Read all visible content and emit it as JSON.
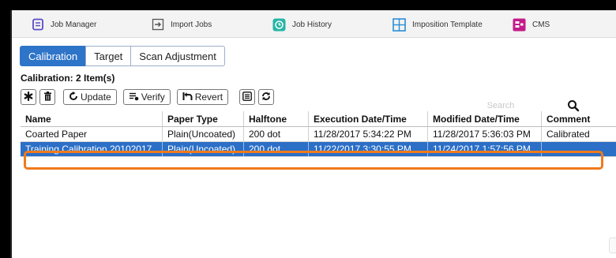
{
  "toolbar": {
    "items": [
      {
        "label": "Job Manager",
        "icon": "job-manager-icon",
        "color": "#5b4cc4"
      },
      {
        "label": "Import Jobs",
        "icon": "import-icon",
        "color": "#555555"
      },
      {
        "label": "Job History",
        "icon": "history-icon",
        "color": "#27b5a6"
      },
      {
        "label": "Imposition Template",
        "icon": "grid-icon",
        "color": "#2a8ed4"
      },
      {
        "label": "CMS",
        "icon": "cms-icon",
        "color": "#c21c8a"
      }
    ]
  },
  "tabs": [
    {
      "label": "Calibration",
      "active": true
    },
    {
      "label": "Target",
      "active": false
    },
    {
      "label": "Scan Adjustment",
      "active": false
    }
  ],
  "count_label": "Calibration: 2 Item(s)",
  "actions": {
    "update": "Update",
    "verify": "Verify",
    "revert": "Revert"
  },
  "search": {
    "placeholder": "Search"
  },
  "table": {
    "columns": [
      "Name",
      "Paper Type",
      "Halftone",
      "Execution Date/Time",
      "Modified Date/Time",
      "Comment"
    ],
    "rows": [
      [
        "Coarted Paper",
        "Plain(Uncoated)",
        "200 dot",
        "11/28/2017 5:34:22 PM",
        "11/28/2017 5:36:03 PM",
        "Calibrated"
      ],
      [
        "Training Calibration 20102017",
        "Plain(Uncoated)",
        "200 dot",
        "11/22/2017 3:30:55 PM",
        "11/24/2017 1:57:56 PM",
        ""
      ]
    ],
    "selected_row": 1
  },
  "colors": {
    "accent": "#2e74c8",
    "selection": "#2b6fc7",
    "highlight": "#f07a1a"
  }
}
